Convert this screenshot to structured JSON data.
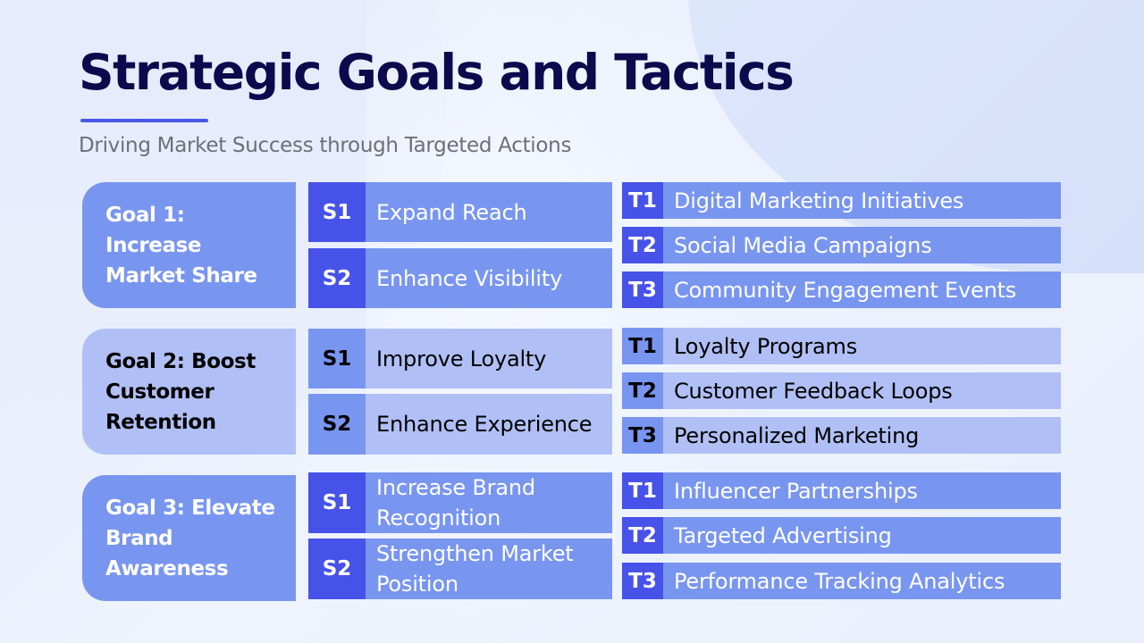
{
  "header": {
    "title": "Strategic Goals and Tactics",
    "subtitle": "Driving Market Success through Targeted Actions"
  },
  "colors": {
    "title": "#0b0a4d",
    "accent": "#4a57e6",
    "badge_dark": "#4752e8",
    "box_medium": "#7895f0",
    "box_light": "#b0c0f6"
  },
  "goals": [
    {
      "label": "Goal 1: Increase Market Share",
      "strategies": [
        {
          "code": "S1",
          "label": "Expand Reach"
        },
        {
          "code": "S2",
          "label": "Enhance Visibility"
        }
      ],
      "tactics": [
        {
          "code": "T1",
          "label": "Digital Marketing Initiatives"
        },
        {
          "code": "T2",
          "label": "Social Media Campaigns"
        },
        {
          "code": "T3",
          "label": "Community Engagement Events"
        }
      ]
    },
    {
      "label": "Goal 2: Boost Customer Retention",
      "strategies": [
        {
          "code": "S1",
          "label": "Improve Loyalty"
        },
        {
          "code": "S2",
          "label": "Enhance Experience"
        }
      ],
      "tactics": [
        {
          "code": "T1",
          "label": "Loyalty Programs"
        },
        {
          "code": "T2",
          "label": "Customer Feedback Loops"
        },
        {
          "code": "T3",
          "label": "Personalized Marketing"
        }
      ]
    },
    {
      "label": "Goal 3: Elevate Brand Awareness",
      "strategies": [
        {
          "code": "S1",
          "label": "Increase Brand Recognition"
        },
        {
          "code": "S2",
          "label": "Strengthen Market Position"
        }
      ],
      "tactics": [
        {
          "code": "T1",
          "label": "Influencer Partnerships"
        },
        {
          "code": "T2",
          "label": "Targeted Advertising"
        },
        {
          "code": "T3",
          "label": "Performance Tracking Analytics"
        }
      ]
    }
  ]
}
